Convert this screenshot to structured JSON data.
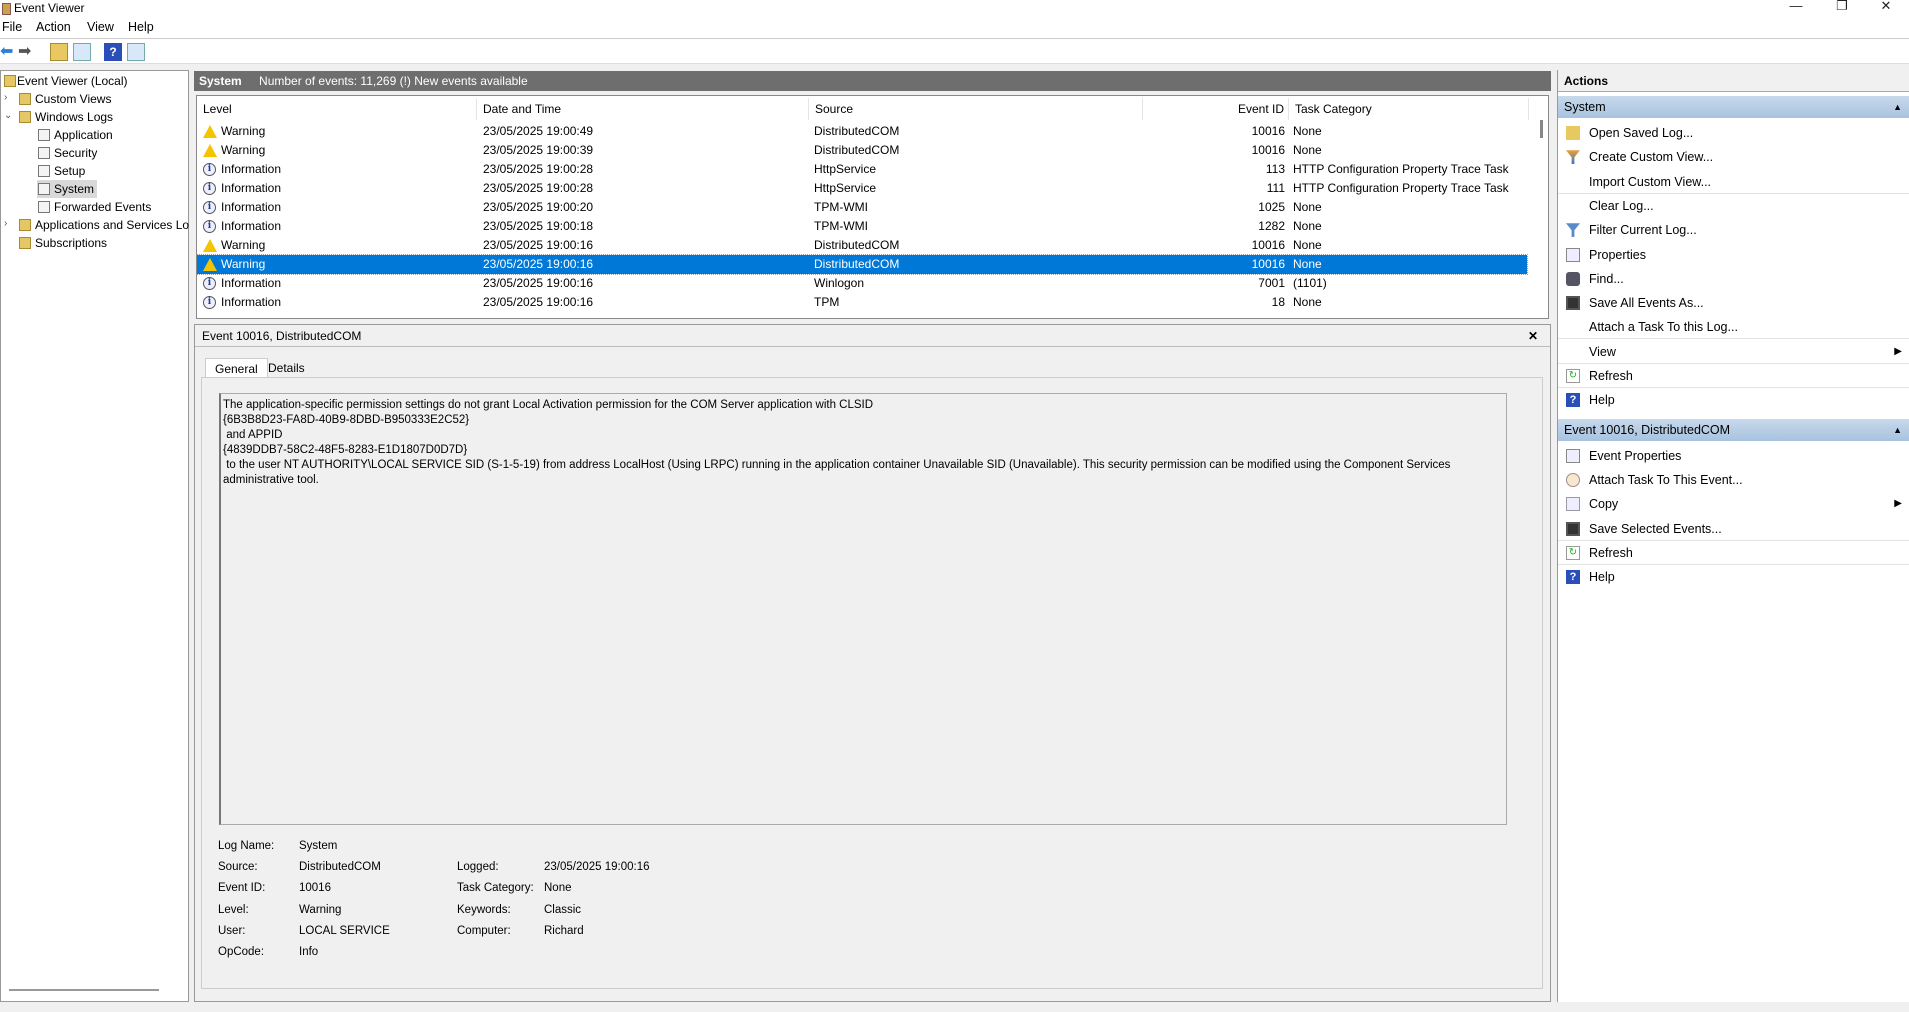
{
  "window": {
    "title": "Event Viewer",
    "controls": [
      "—",
      "❐",
      "✕"
    ]
  },
  "menu": [
    "File",
    "Action",
    "View",
    "Help"
  ],
  "toolbar": [
    "back",
    "forward",
    "up-folder",
    "show-hide-console-tree",
    "help",
    "show-hide-action-pane"
  ],
  "tree": [
    {
      "label": "Event Viewer (Local)",
      "level": 0,
      "icon": "event-viewer-icon"
    },
    {
      "label": "Custom Views",
      "level": 1,
      "icon": "folder-filter-icon",
      "chev": "›"
    },
    {
      "label": "Windows Logs",
      "level": 1,
      "icon": "folder-logs-icon",
      "chev": "⌄"
    },
    {
      "label": "Application",
      "level": 2,
      "icon": "log-icon"
    },
    {
      "label": "Security",
      "level": 2,
      "icon": "log-icon"
    },
    {
      "label": "Setup",
      "level": 2,
      "icon": "log-icon"
    },
    {
      "label": "System",
      "level": 2,
      "icon": "log-icon",
      "selected": true
    },
    {
      "label": "Forwarded Events",
      "level": 2,
      "icon": "log-icon"
    },
    {
      "label": "Applications and Services Lo",
      "level": 1,
      "icon": "folder-icon",
      "chev": "›"
    },
    {
      "label": "Subscriptions",
      "level": 1,
      "icon": "subscriptions-icon"
    }
  ],
  "center": {
    "log_name": "System",
    "summary": "Number of events: 11,269 (!) New events available"
  },
  "columns": [
    "Level",
    "Date and Time",
    "Source",
    "Event ID",
    "Task Category"
  ],
  "events": [
    {
      "level": "Warning",
      "date": "23/05/2025 19:00:49",
      "source": "DistributedCOM",
      "id": "10016",
      "task": "None"
    },
    {
      "level": "Warning",
      "date": "23/05/2025 19:00:39",
      "source": "DistributedCOM",
      "id": "10016",
      "task": "None"
    },
    {
      "level": "Information",
      "date": "23/05/2025 19:00:28",
      "source": "HttpService",
      "id": "113",
      "task": "HTTP Configuration Property Trace Task"
    },
    {
      "level": "Information",
      "date": "23/05/2025 19:00:28",
      "source": "HttpService",
      "id": "111",
      "task": "HTTP Configuration Property Trace Task"
    },
    {
      "level": "Information",
      "date": "23/05/2025 19:00:20",
      "source": "TPM-WMI",
      "id": "1025",
      "task": "None"
    },
    {
      "level": "Information",
      "date": "23/05/2025 19:00:18",
      "source": "TPM-WMI",
      "id": "1282",
      "task": "None"
    },
    {
      "level": "Warning",
      "date": "23/05/2025 19:00:16",
      "source": "DistributedCOM",
      "id": "10016",
      "task": "None"
    },
    {
      "level": "Warning",
      "date": "23/05/2025 19:00:16",
      "source": "DistributedCOM",
      "id": "10016",
      "task": "None",
      "selected": true
    },
    {
      "level": "Information",
      "date": "23/05/2025 19:00:16",
      "source": "Winlogon",
      "id": "7001",
      "task": "(1101)"
    },
    {
      "level": "Information",
      "date": "23/05/2025 19:00:16",
      "source": "TPM",
      "id": "18",
      "task": "None"
    }
  ],
  "detail": {
    "title": "Event 10016, DistributedCOM",
    "close": "✕",
    "tabs": [
      "General",
      "Details"
    ],
    "message": "The application-specific permission settings do not grant Local Activation permission for the COM Server application with CLSID\n{6B3B8D23-FA8D-40B9-8DBD-B950333E2C52}\n and APPID\n{4839DDB7-58C2-48F5-8283-E1D1807D0D7D}\n to the user NT AUTHORITY\\LOCAL SERVICE SID (S-1-5-19) from address LocalHost (Using LRPC) running in the application container Unavailable SID (Unavailable). This security permission can be modified using the Component Services administrative tool.",
    "fields_left": [
      [
        "Log Name:",
        "System"
      ],
      [
        "Source:",
        "DistributedCOM"
      ],
      [
        "Event ID:",
        "10016"
      ],
      [
        "Level:",
        "Warning"
      ],
      [
        "User:",
        "LOCAL SERVICE"
      ],
      [
        "OpCode:",
        "Info"
      ]
    ],
    "fields_right": [
      [
        "Logged:",
        "23/05/2025 19:00:16"
      ],
      [
        "Task Category:",
        "None"
      ],
      [
        "Keywords:",
        "Classic"
      ],
      [
        "Computer:",
        "Richard"
      ]
    ]
  },
  "actions": {
    "title": "Actions",
    "sections": [
      {
        "title": "System",
        "items": [
          {
            "label": "Open Saved Log...",
            "icon": "open-folder-icon"
          },
          {
            "label": "Create Custom View...",
            "icon": "filter-new-icon"
          },
          {
            "label": "Import Custom View...",
            "icon": "",
            "sep": true
          },
          {
            "label": "Clear Log...",
            "icon": ""
          },
          {
            "label": "Filter Current Log...",
            "icon": "filter-icon"
          },
          {
            "label": "Properties",
            "icon": "properties-icon"
          },
          {
            "label": "Find...",
            "icon": "binoculars-icon"
          },
          {
            "label": "Save All Events As...",
            "icon": "save-icon"
          },
          {
            "label": "Attach a Task To this Log...",
            "icon": "",
            "sep": true
          },
          {
            "label": "View",
            "icon": "",
            "submenu": true,
            "sep": true
          },
          {
            "label": "Refresh",
            "icon": "refresh-icon",
            "sep": true
          },
          {
            "label": "Help",
            "icon": "help-icon"
          }
        ]
      },
      {
        "title": "Event 10016, DistributedCOM",
        "items": [
          {
            "label": "Event Properties",
            "icon": "properties-icon"
          },
          {
            "label": "Attach Task To This Event...",
            "icon": "task-clock-icon"
          },
          {
            "label": "Copy",
            "icon": "copy-icon",
            "submenu": true
          },
          {
            "label": "Save Selected Events...",
            "icon": "save-icon",
            "sep": true
          },
          {
            "label": "Refresh",
            "icon": "refresh-icon",
            "sep": true
          },
          {
            "label": "Help",
            "icon": "help-icon"
          }
        ]
      }
    ]
  },
  "colors": {
    "selection": "#0078d7",
    "section_band": "#b8cfe6",
    "center_header": "#6e6e6e",
    "warning": "#f5c400"
  }
}
